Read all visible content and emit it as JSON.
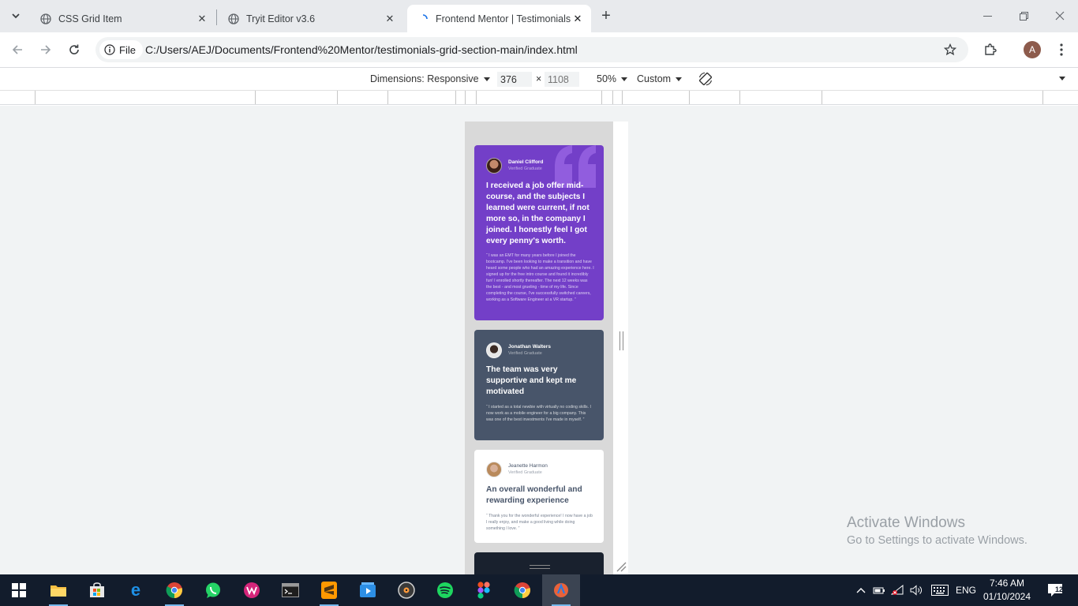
{
  "browser": {
    "tabs": [
      {
        "title": "CSS Grid Item",
        "active": false
      },
      {
        "title": "Tryit Editor v3.6",
        "active": false
      },
      {
        "title": "Frontend Mentor | Testimonials",
        "active": true
      }
    ],
    "address": {
      "scheme_label": "File",
      "url": "C:/Users/AEJ/Documents/Frontend%20Mentor/testimonials-grid-section-main/index.html"
    },
    "profile_initial": "A"
  },
  "device_toolbar": {
    "dimensions_label": "Dimensions: Responsive",
    "width": "376",
    "times": "×",
    "height_placeholder": "1108",
    "zoom": "50%",
    "throttle": "Custom"
  },
  "testimonials": [
    {
      "name": "Daniel Clifford",
      "status": "Verified Graduate",
      "quote": "I received a job offer mid-course, and the subjects I learned were current, if not more so, in the company I joined. I honestly feel I got every penny's worth.",
      "body": "“ I was an EMT for many years before I joined the bootcamp. I've been looking to make a transition and have heard some people who had an amazing experience here. I signed up for the free intro course and found it incredibly fun! I enrolled shortly thereafter. The next 12 weeks was the best - and most grueling - time of my life. Since completing the course, I've successfully switched careers, working as a Software Engineer at a VR startup. ”",
      "bg": "#733fc8"
    },
    {
      "name": "Jonathan Walters",
      "status": "Verified Graduate",
      "quote": "The team was very supportive and kept me motivated",
      "body": "“ I started as a total newbie with virtually no coding skills. I now work as a mobile engineer for a big company. This was one of the best investments I've made in myself. ”",
      "bg": "#48556a"
    },
    {
      "name": "Jeanette Harmon",
      "status": "Verified Graduate",
      "quote": "An overall wonderful and rewarding experience",
      "body": "“ Thank you for the wonderful experience! I now have a job I really enjoy, and make a good living while doing something I love. ”",
      "bg": "#ffffff"
    }
  ],
  "watermark": {
    "line1": "Activate Windows",
    "line2": "Go to Settings to activate Windows."
  },
  "taskbar": {
    "language": "ENG",
    "time": "7:46 AM",
    "date": "01/10/2024",
    "notification_count": "12"
  }
}
